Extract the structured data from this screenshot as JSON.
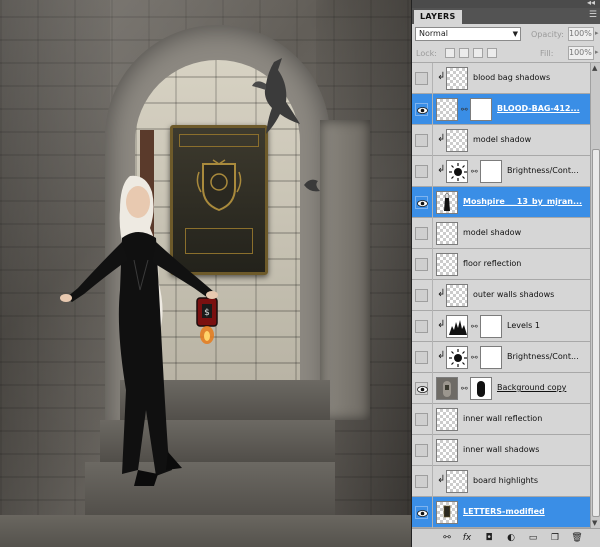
{
  "panel": {
    "tab_label": "LAYERS",
    "collapse_glyph": "◂◂",
    "menu_glyph": "☰",
    "blend_mode": "Normal",
    "opacity_label": "Opacity:",
    "opacity_value": "100%",
    "lock_label": "Lock:",
    "fill_label": "Fill:",
    "fill_value": "100%"
  },
  "layers": [
    {
      "name": "blood bag shadows",
      "visible": false,
      "clipped": true,
      "thumb": "transparent",
      "selected": false
    },
    {
      "name": "BLOOD-BAG-412...",
      "visible": true,
      "clipped": false,
      "thumb": "transparent",
      "mask": true,
      "selected": true
    },
    {
      "name": "model shadow",
      "visible": false,
      "clipped": true,
      "thumb": "transparent",
      "selected": false
    },
    {
      "name": "Brightness/Cont...",
      "visible": false,
      "clipped": true,
      "thumb": "brightness",
      "mask": true,
      "selected": false
    },
    {
      "name": "Moshpire___13_by_mjran...",
      "visible": true,
      "clipped": false,
      "thumb": "figure",
      "selected": true
    },
    {
      "name": "model shadow",
      "visible": false,
      "clipped": false,
      "thumb": "transparent",
      "selected": false
    },
    {
      "name": "floor reflection",
      "visible": false,
      "clipped": false,
      "thumb": "transparent",
      "selected": false
    },
    {
      "name": "outer walls shadows",
      "visible": false,
      "clipped": true,
      "thumb": "transparent",
      "selected": false
    },
    {
      "name": "Levels 1",
      "visible": false,
      "clipped": true,
      "thumb": "levels",
      "mask": true,
      "selected": false
    },
    {
      "name": "Brightness/Cont...",
      "visible": false,
      "clipped": true,
      "thumb": "brightness",
      "mask": true,
      "selected": false
    },
    {
      "name": "Background copy",
      "visible": true,
      "clipped": false,
      "thumb": "photo",
      "mask": true,
      "selected": false,
      "underline": true
    },
    {
      "name": "inner wall reflection",
      "visible": false,
      "clipped": false,
      "thumb": "transparent",
      "selected": false
    },
    {
      "name": "inner wall shadows",
      "visible": false,
      "clipped": false,
      "thumb": "transparent",
      "selected": false
    },
    {
      "name": "board highlights",
      "visible": false,
      "clipped": true,
      "thumb": "transparent",
      "selected": false
    },
    {
      "name": "LETTERS-modified",
      "visible": true,
      "clipped": false,
      "thumb": "letters",
      "selected": true
    }
  ],
  "footer_icons": [
    "link-icon",
    "fx-icon",
    "mask-icon",
    "adjustment-icon",
    "folder-icon",
    "new-layer-icon",
    "trash-icon"
  ],
  "colors": {
    "selected": "#3a8ee6",
    "panel_bg": "#d6d6d6"
  }
}
